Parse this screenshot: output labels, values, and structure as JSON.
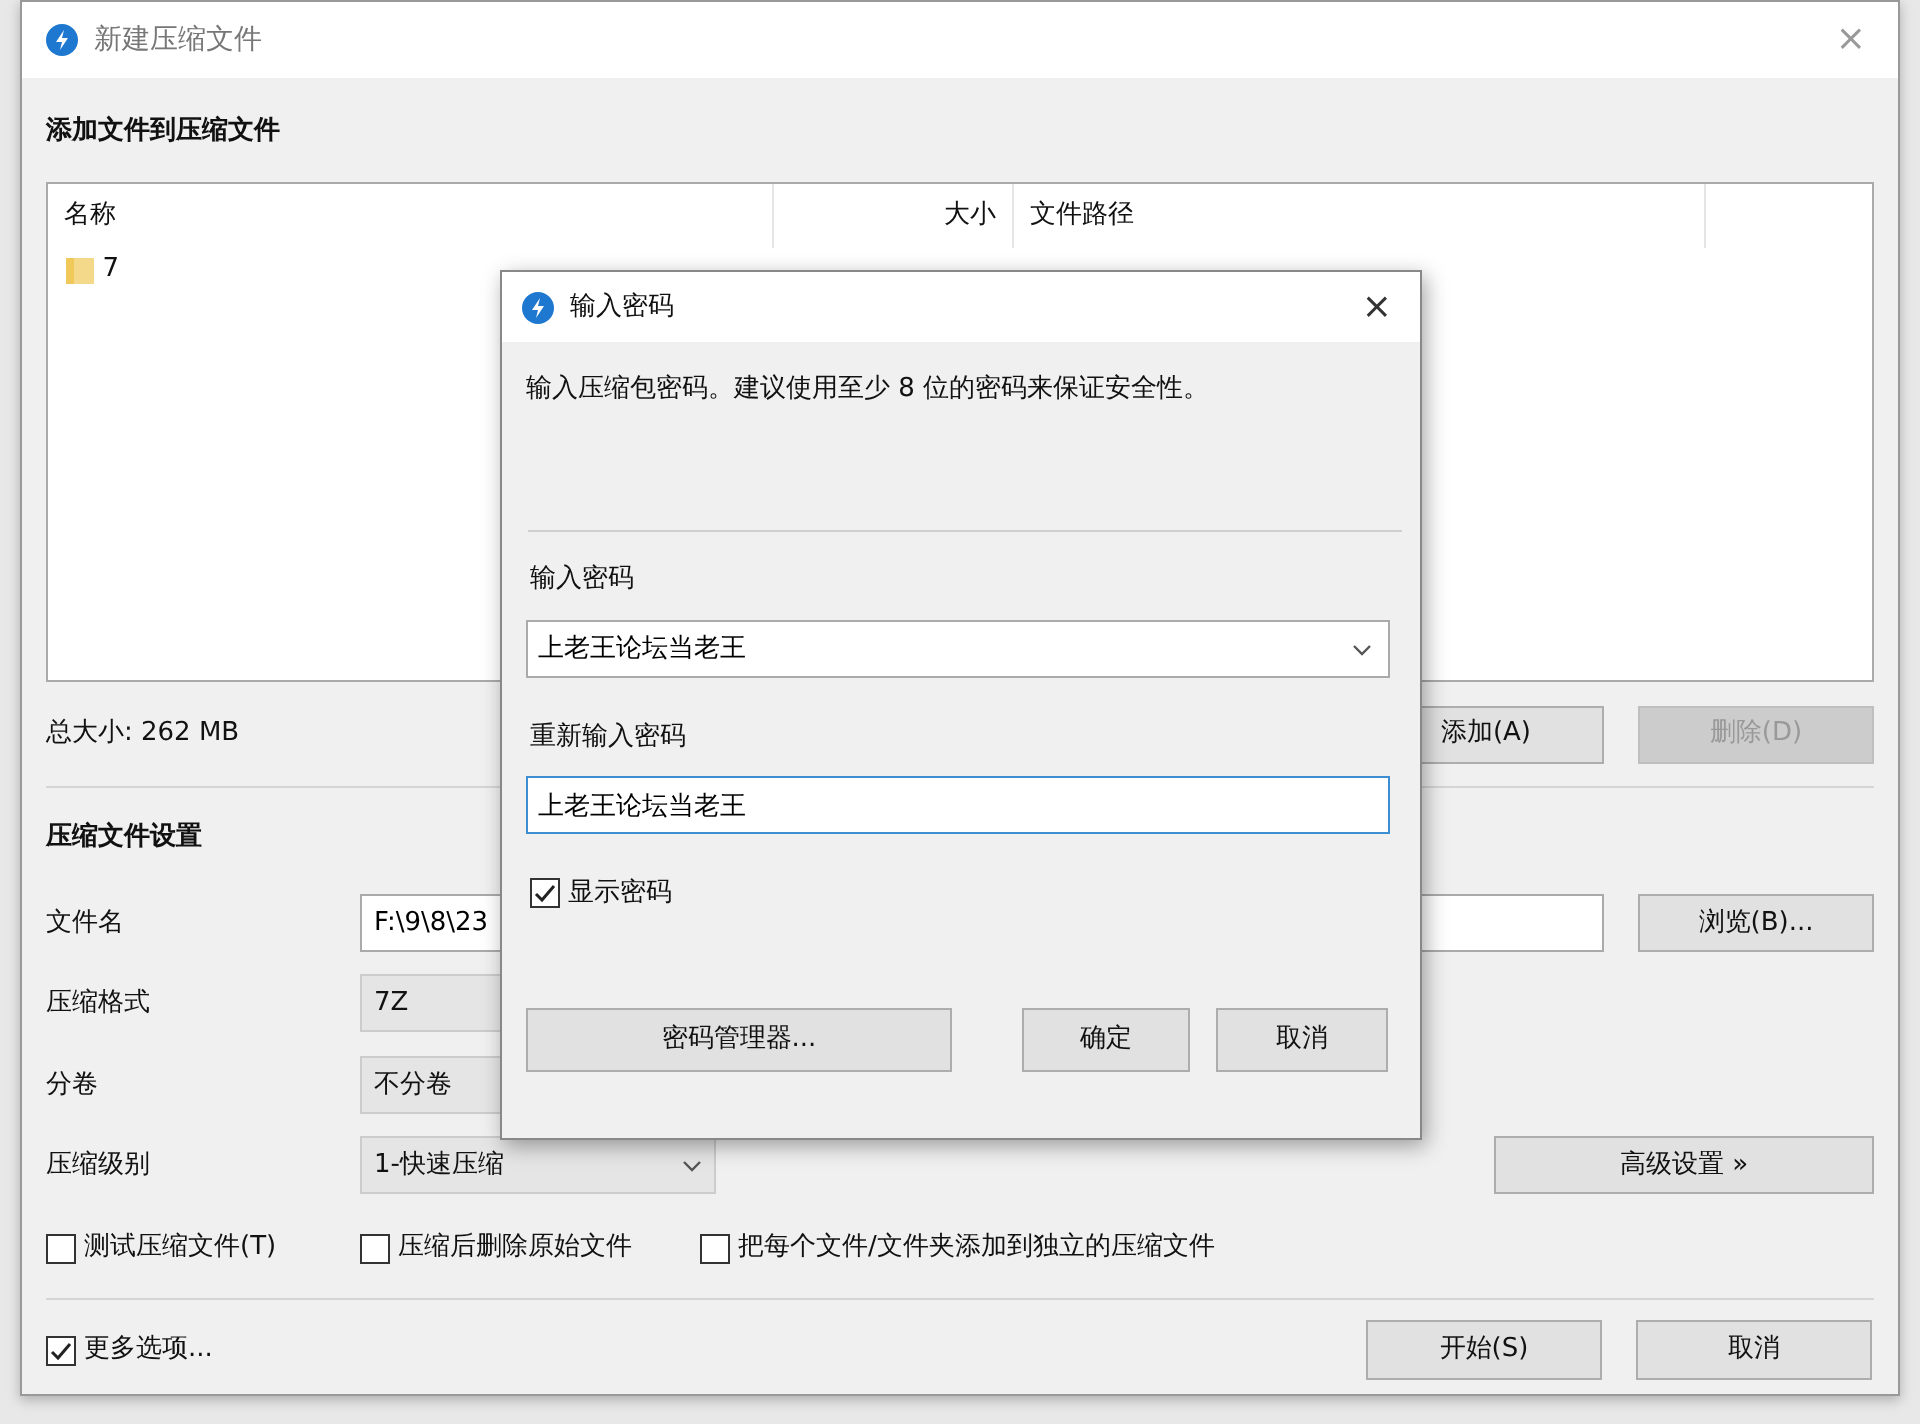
{
  "main_window": {
    "title": "新建压缩文件",
    "close_label": "×",
    "files_heading": "添加文件到压缩文件",
    "file_list": {
      "columns": [
        "名称",
        "大小",
        "文件路径"
      ],
      "rows": [
        {
          "name": "7"
        }
      ]
    },
    "total_size": "总大小: 262 MB",
    "list_buttons": [
      {
        "label": "添加(A)",
        "disabled": false
      },
      {
        "label": "删除(D)",
        "disabled": true
      }
    ],
    "settings_heading": "压缩文件设置",
    "fields": [
      {
        "kind": "text",
        "label": "文件名",
        "value": "F:\\9\\8\\23",
        "button": "浏览(B)..."
      },
      {
        "kind": "select",
        "label": "压缩格式",
        "value": "7Z"
      },
      {
        "kind": "select",
        "label": "分卷",
        "value": "不分卷"
      },
      {
        "kind": "select",
        "label": "压缩级别",
        "value": "1-快速压缩",
        "arrow": true,
        "button": "高级设置 »"
      }
    ],
    "options": [
      {
        "label": "测试压缩文件(T)",
        "checked": false
      },
      {
        "label": "压缩后删除原始文件",
        "checked": false
      },
      {
        "label": "把每个文件/文件夹添加到独立的压缩文件",
        "checked": false
      }
    ],
    "more_options": {
      "label": "更多选项...",
      "checked": true
    },
    "buttons": [
      "开始(S)",
      "取消"
    ]
  },
  "password_dialog": {
    "title": "输入密码",
    "close_label": "×",
    "message": "输入压缩包密码。建议使用至少 8 位的密码来保证安全性。",
    "fields": [
      {
        "kind": "combo",
        "label": "输入密码",
        "value": "上老王论坛当老王",
        "focused": false
      },
      {
        "kind": "text",
        "label": "重新输入密码",
        "value": "上老王论坛当老王",
        "focused": true
      }
    ],
    "show_password": {
      "label": "显示密码",
      "checked": true
    },
    "manager_button": "密码管理器...",
    "buttons": [
      "确定",
      "取消"
    ]
  }
}
